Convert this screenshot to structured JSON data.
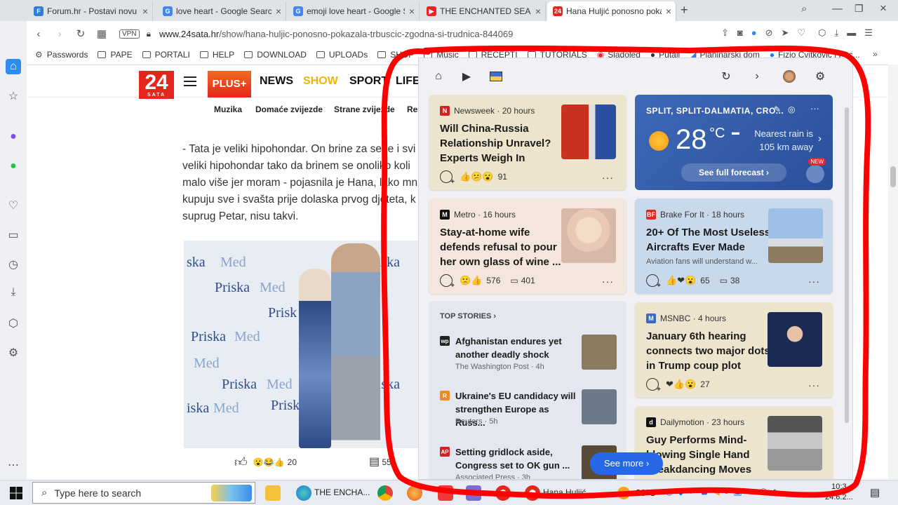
{
  "browser": {
    "tabs": [
      {
        "title": "Forum.hr - Postavi novu te",
        "color": "#2e7dd7",
        "glyph": "F"
      },
      {
        "title": "love heart - Google Search",
        "color": "#4285f4",
        "glyph": "G"
      },
      {
        "title": "emoji love heart - Google S",
        "color": "#4285f4",
        "glyph": "G"
      },
      {
        "title": "THE ENCHANTED SEA (The",
        "color": "#e22",
        "glyph": "▶"
      },
      {
        "title": "Hana Huljić ponosno poka",
        "color": "#e4261d",
        "glyph": "24"
      }
    ],
    "new_tab": "+",
    "url_host": "www.24sata.hr",
    "url_path": "/show/hana-huljic-ponosno-pokazala-trbuscic-zgodna-si-trudnica-844069",
    "vpn_label": "VPN",
    "bookmarks": [
      "Passwords",
      "PAPE",
      "PORTALI",
      "HELP",
      "DOWNLOAD",
      "UPLOADs",
      "SHOP",
      "Music",
      "RECEPTI",
      "TUTORIALS",
      "Sladoled",
      "Putali",
      "Planinarski dom",
      "Fizio Cvitković | Fac..."
    ]
  },
  "site": {
    "logo_number": "24",
    "logo_word": "SATA",
    "plus_label": "PLUS+",
    "nav": [
      {
        "label": "NEWS",
        "color": "#111111"
      },
      {
        "label": "SHOW",
        "color": "#f4b400"
      },
      {
        "label": "SPORT",
        "color": "#111111"
      },
      {
        "label": "LIFE",
        "color": "#111111"
      }
    ],
    "subnav": [
      "Muzika",
      "Domaće zvijezde",
      "Strane zvijezde",
      "Rea"
    ],
    "article_lines": [
      "- Tata je veliki hipohondar. On brine za sebe i svi",
      "veliki hipohondar tako da brinem se onoliko koli",
      "malo više jer moram - pojasnila je Hana, lako mn",
      "kupuju sve i svašta prije dolaska prvog djeteta, k",
      "suprug Petar, nisu takvi."
    ],
    "reaction_count": "20",
    "comment_count": "55"
  },
  "panel": {
    "cards": [
      {
        "source": "Newsweek",
        "time": "20 hours",
        "headline_lines": [
          "Will China-Russia",
          "Relationship Unravel?",
          "Experts Weigh In"
        ],
        "reactions": "91",
        "comments": "",
        "bg": "#ece4cd",
        "logo_bg": "#d32020",
        "logo_glyph": "N"
      },
      {
        "source": "Metro",
        "time": "16 hours",
        "headline_lines": [
          "Stay-at-home wife",
          "defends refusal to pour",
          "her own glass of wine ..."
        ],
        "reactions": "576",
        "comments": "401",
        "bg": "#f4e6dc",
        "logo_bg": "#111111",
        "logo_glyph": "M"
      },
      {
        "source": "Brake For It",
        "time": "18 hours",
        "headline_lines": [
          "20+ Of The Most Useless",
          "Aircrafts Ever Made"
        ],
        "subtitle": "Aviation fans will understand w...",
        "reactions": "65",
        "comments": "38",
        "bg": "#c9d9ec",
        "logo_bg": "#e4261d",
        "logo_glyph": "BF"
      },
      {
        "source": "MSNBC",
        "time": "4 hours",
        "headline_lines": [
          "January 6th hearing",
          "connects two major dots",
          "in Trump coup plot"
        ],
        "reactions": "27",
        "comments": "",
        "bg": "#ece4cd",
        "logo_bg": "#3a6bc4",
        "logo_glyph": "M"
      },
      {
        "source": "Dailymotion",
        "time": "23 hours",
        "headline_lines": [
          "Guy Performs Mind-",
          "blowing Single Hand",
          "Breakdancing Moves"
        ],
        "reactions": "",
        "comments": "",
        "bg": "#ece4cd",
        "logo_bg": "#111111",
        "logo_glyph": "d"
      }
    ],
    "weather": {
      "location": "SPLIT, SPLIT-DALMATIA, CRO...",
      "temp": "28",
      "unit": "°C",
      "rain_line1": "Nearest rain is",
      "rain_line2": "105 km away",
      "forecast_label": "See full forecast ›",
      "new_badge": "NEW"
    },
    "top_stories": {
      "heading": "TOP STORIES ›",
      "items": [
        {
          "headline_lines": [
            "Afghanistan endures yet",
            "another deadly shock"
          ],
          "source": "The Washington Post · 4h",
          "logo_bg": "#222222",
          "logo_glyph": "wp",
          "img": "#8a7a60"
        },
        {
          "headline_lines": [
            "Ukraine's EU candidacy will",
            "strengthen Europe as Russ..."
          ],
          "source": "Reuters · 5h",
          "logo_bg": "#f08a24",
          "logo_glyph": "R",
          "img": "#6a7a8a"
        },
        {
          "headline_lines": [
            "Setting gridlock aside,",
            "Congress set to OK gun ..."
          ],
          "source": "Associated Press · 3h",
          "logo_bg": "#d32020",
          "logo_glyph": "AP",
          "img": "#5a4a3a"
        }
      ]
    },
    "see_more": "See more ›"
  },
  "taskbar": {
    "search_placeholder": "Type here to search",
    "edge_label": "THE ENCHA...",
    "opera_label": "Hana Huljić ...",
    "temp": "28°C",
    "time": "10:3",
    "date": "24.6.2..."
  },
  "colors": {
    "annotation": "#ff0000",
    "accent": "#2768e6",
    "opera": "#e4261d"
  }
}
